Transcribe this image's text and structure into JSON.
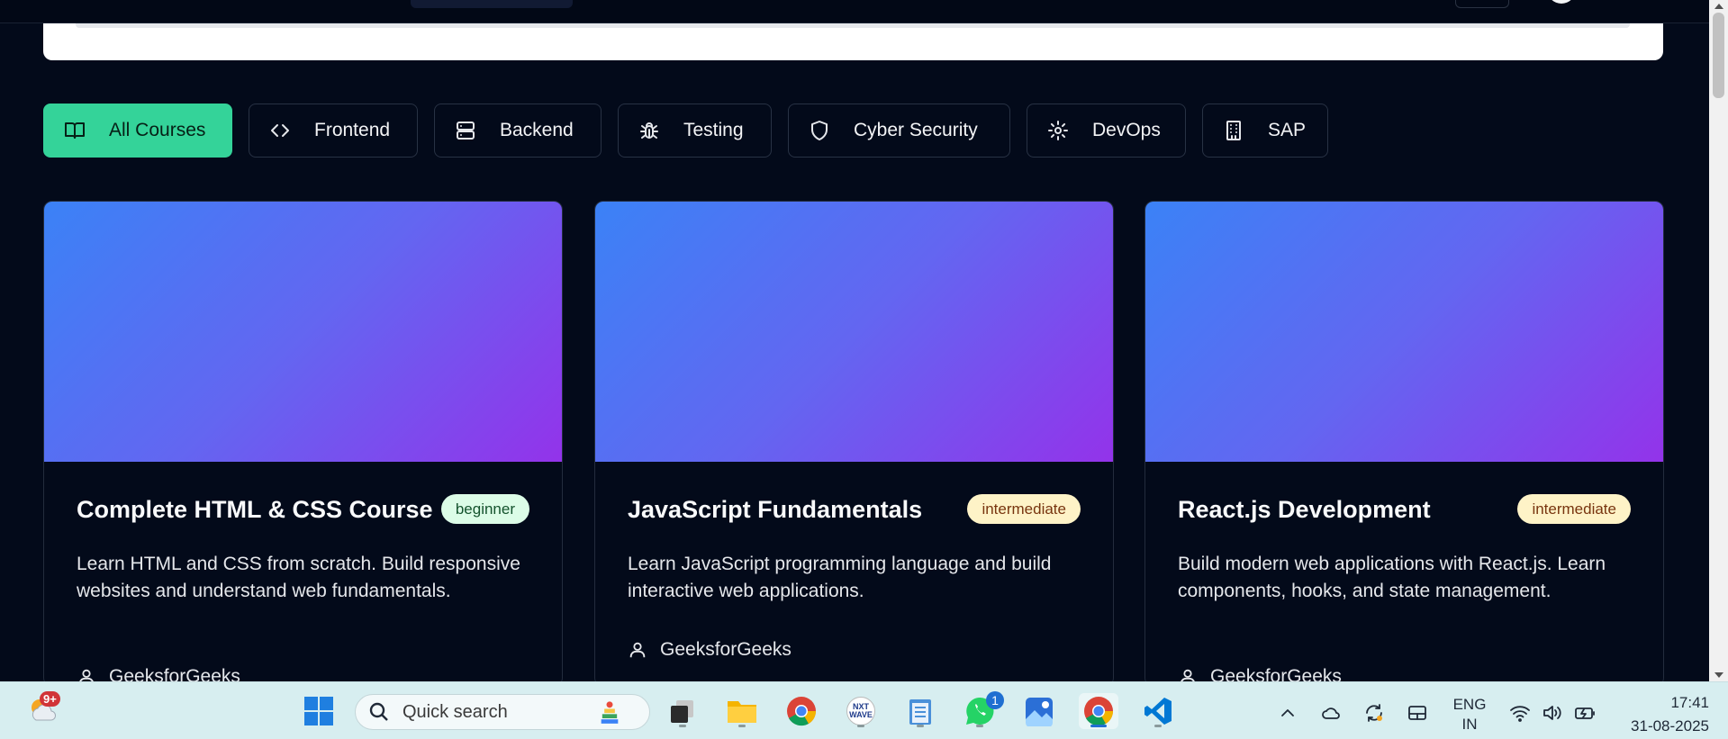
{
  "tabs": [
    {
      "label": "All Courses",
      "icon": "book-open-icon",
      "active": true
    },
    {
      "label": "Frontend",
      "icon": "code-icon",
      "active": false
    },
    {
      "label": "Backend",
      "icon": "server-icon",
      "active": false
    },
    {
      "label": "Testing",
      "icon": "bug-icon",
      "active": false
    },
    {
      "label": "Cyber Security",
      "icon": "shield-icon",
      "active": false
    },
    {
      "label": "DevOps",
      "icon": "gear-icon",
      "active": false
    },
    {
      "label": "SAP",
      "icon": "building-icon",
      "active": false
    }
  ],
  "courses": [
    {
      "title": "Complete HTML & CSS Course",
      "level": "beginner",
      "description": "Learn HTML and CSS from scratch. Build responsive websites and understand web fundamentals.",
      "author": "GeeksforGeeks"
    },
    {
      "title": "JavaScript Fundamentals",
      "level": "intermediate",
      "description": "Learn JavaScript programming language and build interactive web applications.",
      "author": "GeeksforGeeks"
    },
    {
      "title": "React.js Development",
      "level": "intermediate",
      "description": "Build modern web applications with React.js. Learn components, hooks, and state management.",
      "author": "GeeksforGeeks"
    }
  ],
  "colors": {
    "accent": "#34d399",
    "background": "#030a1a",
    "gradient_start": "#3b82f6",
    "gradient_end": "#9333ea"
  },
  "taskbar": {
    "search_placeholder": "Quick search",
    "weather_badge": "9+",
    "whatsapp_badge": "1",
    "language": "ENG",
    "region": "IN",
    "time": "17:41",
    "date": "31-08-2025",
    "nxt_label": "NXT WAVE"
  }
}
